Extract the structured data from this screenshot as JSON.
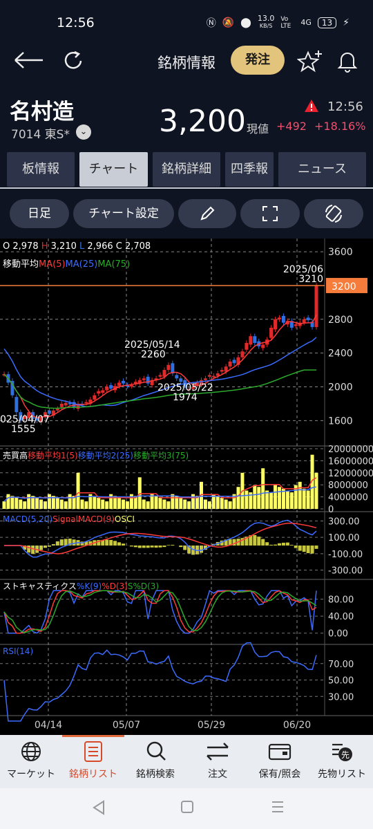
{
  "status_bar": {
    "time": "12:56",
    "net_speed": "13.0",
    "net_unit": "KB/S",
    "volte": "Vo LTE",
    "signal": "4G",
    "battery": "13"
  },
  "header": {
    "title": "銘柄情報",
    "order_button": "発注"
  },
  "stock": {
    "name": "名村造",
    "code": "7014 東S*",
    "price": "3,200",
    "price_label": "現値",
    "change": "+492",
    "change_pct": "+18.16%",
    "time": "12:56"
  },
  "tabs": [
    "板情報",
    "チャート",
    "銘柄詳細",
    "四季報",
    "ニュース"
  ],
  "toolbar": {
    "period": "日足",
    "settings": "チャート設定"
  },
  "colors": {
    "up": "#e02a2a",
    "down": "#2f6fe0",
    "ma5": "#ff3b3b",
    "ma25": "#3b6cff",
    "ma75": "#2cab2c",
    "volume": "#ffff66",
    "current_price": "#f57c3a"
  },
  "chart_data": {
    "type": "candlestick",
    "ohlc_label": {
      "o": "2,978",
      "h": "3,210",
      "l": "2,966",
      "c": "2,708"
    },
    "ma_legend": {
      "label": "移動平均",
      "ma5": "MA(5)",
      "ma25": "MA(25)",
      "ma75": "MA(75)"
    },
    "price_ticks": [
      "3600",
      "2800",
      "2400",
      "2000",
      "1600"
    ],
    "price_ylim": [
      1300,
      3650
    ],
    "current_price_tag": "3200",
    "annotations": [
      {
        "date": "2025/06",
        "value": "3210"
      },
      {
        "date": "2025/05/14",
        "value": "2260"
      },
      {
        "date": "2025/05/22",
        "value": "1974"
      },
      {
        "date": "025/04/07",
        "value": "1555"
      }
    ],
    "x_ticks": [
      "04/14",
      "05/07",
      "05/29",
      "06/20"
    ],
    "volume": {
      "legend": [
        "売買高",
        "移動平均1(5)",
        "移動平均2(25)",
        "移動平均3(75)"
      ],
      "ticks": [
        "20000000",
        "16000000",
        "12000000",
        "8000000",
        "4000000",
        "0"
      ],
      "ylim": [
        0,
        20000000
      ]
    },
    "macd": {
      "legend": [
        "MACD(5,20)",
        "SignalMACD(9)",
        "OSCI"
      ],
      "ticks": [
        "300.00",
        "100.00",
        "-100.00",
        "-300.00"
      ],
      "ylim": [
        -380,
        380
      ]
    },
    "stochastics": {
      "legend": [
        "ストキャスティクス",
        "%K(9)",
        "%D(3)",
        "S%D(3)"
      ],
      "ticks": [
        "80.00",
        "40.00",
        "0.00"
      ],
      "ylim": [
        -20,
        120
      ]
    },
    "rsi": {
      "legend": [
        "RSI(14)"
      ],
      "ticks": [
        "70.00",
        "50.00",
        "30.00"
      ],
      "ylim": [
        10,
        90
      ]
    }
  },
  "bottom_nav": [
    "マーケット",
    "銘柄リスト",
    "銘柄検索",
    "注文",
    "保有/照会",
    "先物リスト"
  ]
}
